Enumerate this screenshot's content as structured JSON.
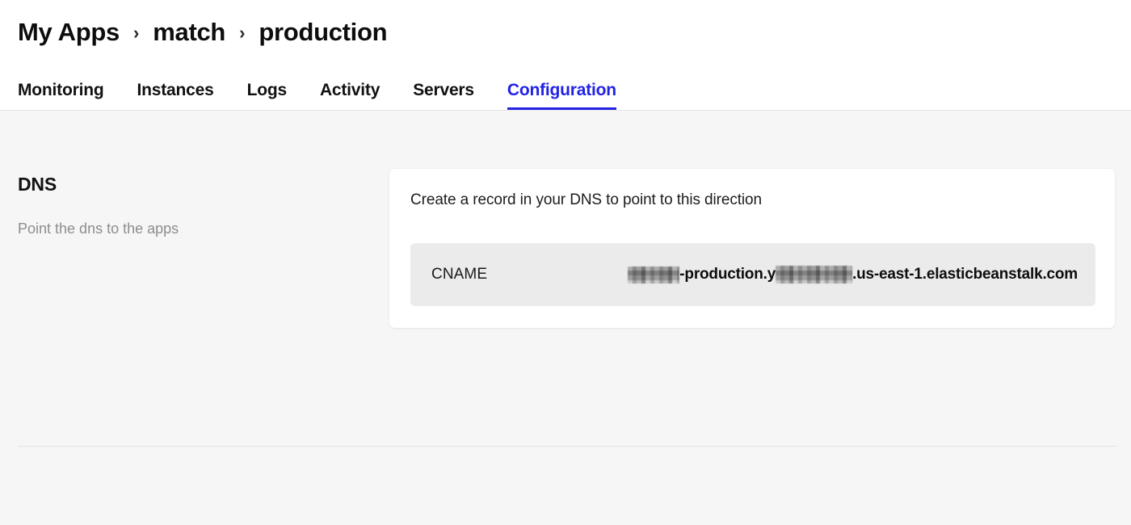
{
  "breadcrumb": {
    "items": [
      {
        "label": "My Apps"
      },
      {
        "label": "match"
      },
      {
        "label": "production"
      }
    ],
    "separator": "›"
  },
  "tabs": [
    {
      "label": "Monitoring",
      "active": false
    },
    {
      "label": "Instances",
      "active": false
    },
    {
      "label": "Logs",
      "active": false
    },
    {
      "label": "Activity",
      "active": false
    },
    {
      "label": "Servers",
      "active": false
    },
    {
      "label": "Configuration",
      "active": true
    }
  ],
  "section": {
    "title": "DNS",
    "description": "Point the dns to the apps"
  },
  "card": {
    "title": "Create a record in your DNS to point to this direction",
    "record": {
      "type": "CNAME",
      "value_parts": [
        {
          "kind": "redacted",
          "width": 64
        },
        {
          "kind": "text",
          "text": "-production.y"
        },
        {
          "kind": "redacted",
          "width": 95
        },
        {
          "kind": "text",
          "text": ".us-east-1.elasticbeanstalk.com"
        }
      ],
      "value_plain": "[redacted]-production.y[redacted].us-east-1.elasticbeanstalk.com"
    }
  },
  "colors": {
    "accent": "#2222e6",
    "page_background": "#f6f6f6",
    "header_background": "#ffffff",
    "card_background": "#ffffff",
    "record_background": "#ebebeb",
    "muted_text": "#8d8d8d",
    "primary_text": "#111111"
  }
}
